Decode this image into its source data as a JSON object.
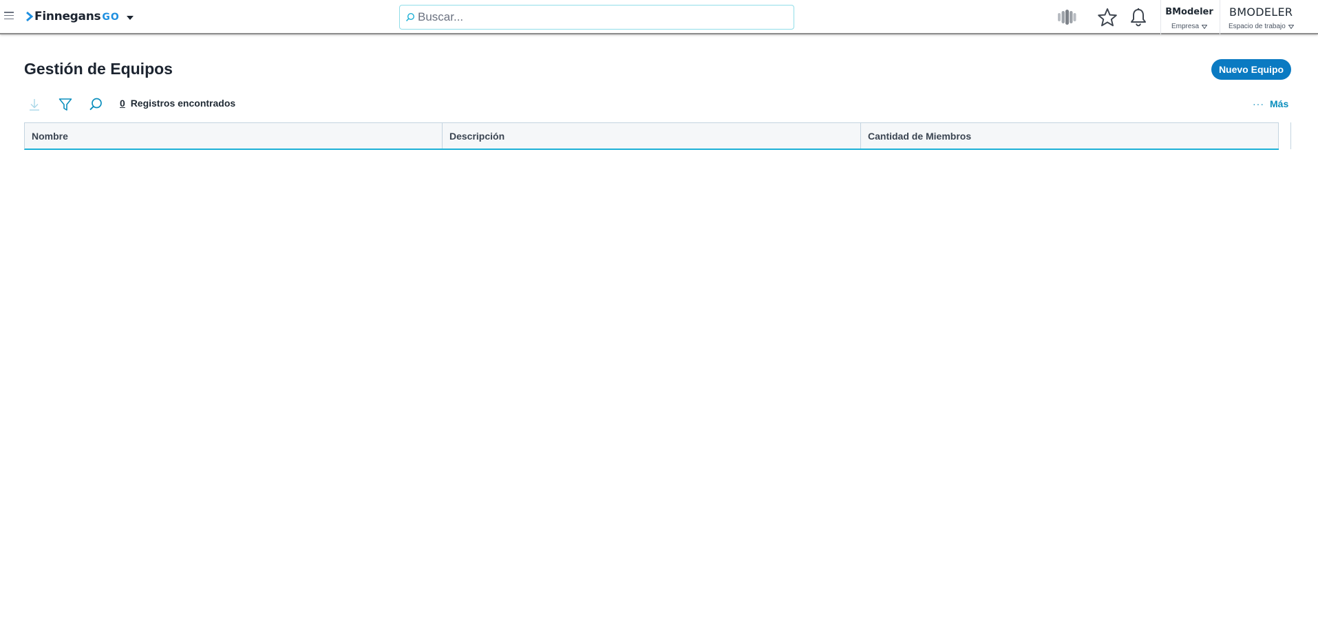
{
  "brand": {
    "name": "Finnegans",
    "suffix": "GO",
    "accent": "#1e8fe0"
  },
  "search": {
    "placeholder": "Buscar..."
  },
  "header_icons": [
    "apps-icon",
    "star-icon",
    "bell-icon"
  ],
  "company": {
    "name": "BModeler",
    "label": "Empresa"
  },
  "workspace": {
    "name": "BMODELER",
    "label": "Espacio de trabajo"
  },
  "page": {
    "title": "Gestión de Equipos",
    "new_button": "Nuevo Equipo"
  },
  "toolbar": {
    "tools": [
      "download-icon",
      "filter-icon",
      "search-icon"
    ],
    "record_count": "0",
    "record_label": "Registros encontrados",
    "more_dots": "···",
    "more_label": "Más"
  },
  "table": {
    "columns": [
      "Nombre",
      "Descripción",
      "Cantidad de Miembros"
    ],
    "rows": []
  },
  "colors": {
    "primary": "#0a7ac2",
    "link": "#0a8ebd",
    "header_underline": "#1bb0d6"
  }
}
